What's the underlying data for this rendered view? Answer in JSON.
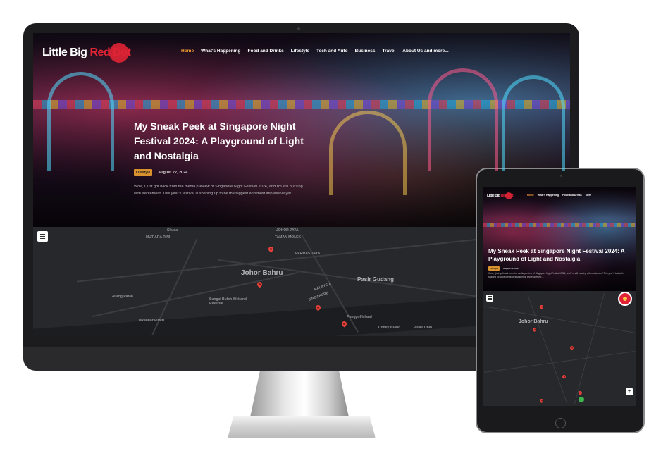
{
  "site": {
    "logo_main": "Little Big",
    "logo_accent": "Red Dot",
    "nav_desktop": [
      "Home",
      "What's Happening",
      "Food and Drinks",
      "Lifestyle",
      "Tech and Auto",
      "Business",
      "Travel",
      "About Us and more..."
    ],
    "nav_tablet": [
      "Home",
      "What's Happening",
      "Food and Drinks",
      "More"
    ],
    "active_nav": "Home"
  },
  "article": {
    "title": "My Sneak Peek at Singapore Night Festival 2024: A Playground of Light and Nostalgia",
    "category": "Lifestyle",
    "date": "August 22, 2024",
    "excerpt": "Wow, I just got back from the media preview of Singapore Night Festival 2024, and I'm still buzzing with excitement! This year's festival is shaping up to be the biggest and most impressive yet....",
    "tablet_excerpt": "Wow, I just got back from the media preview of Singapore Night Festival 2024, and I'm still buzzing with excitement! This year's festival is shaping up to be the biggest and most impressive yet...."
  },
  "map": {
    "city_label": "Johor Bahru",
    "labels": [
      "Skudai",
      "JOHOR JAYA",
      "MUTIARA RINI",
      "TAMAN MOLEK",
      "PERMAS JAYA",
      "Pasir Gudang",
      "Gelang Patah",
      "Iskandar Puteri",
      "MALAYSIA",
      "SINGAPORE",
      "Sungai Buloh Wetland Reserve",
      "Punggol Island",
      "Coney Island",
      "Pulau Ubin"
    ],
    "tablet_city_label": "Johor Bahru"
  },
  "colors": {
    "accent_orange": "#f29a33",
    "brand_red": "#e02435",
    "badge": "#d9922e",
    "pin": "#e8423c",
    "map_bg": "#26282b"
  },
  "icons": [
    "menu-icon",
    "map-pin-icon",
    "chat-badge-icon",
    "zoom-icon"
  ]
}
